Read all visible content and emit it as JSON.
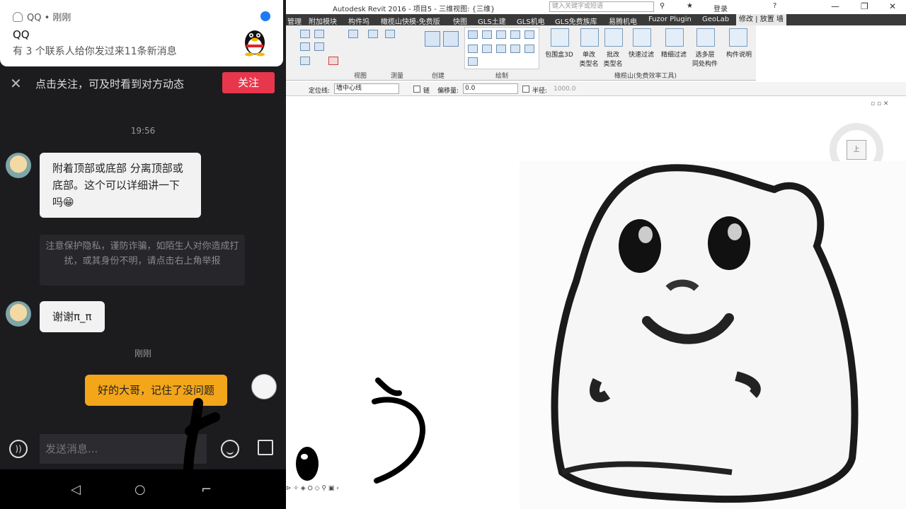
{
  "notification": {
    "app": "QQ • 刚刚",
    "title": "QQ",
    "body": "有 3 个联系人给你发过来11条新消息"
  },
  "follow_bar": {
    "close": "✕",
    "hint": "点击关注，可及时看到对方动态",
    "button": "关注"
  },
  "chat": {
    "time1": "19:56",
    "msg1": "附着顶部或底部 分离顶部或底部。这个可以详细讲一下吗😁",
    "notice": "注意保护隐私，谨防诈骗，如陌生人对你造成打扰，或其身份不明，请点击右上角举报",
    "msg2": "谢谢π_π",
    "time2": "刚刚",
    "msg3": "好的大哥，记住了没问题"
  },
  "input": {
    "placeholder": "发送消息..."
  },
  "nav": {
    "back": "◁",
    "home": "○",
    "recent": "⌐"
  },
  "revit": {
    "title": "Autodesk Revit 2016 -    项目5 - 三维视图: {三维}",
    "search_placeholder": "键入关键字或短语",
    "login": "登录",
    "tabs": [
      "管理",
      "附加模块",
      "构件坞",
      "橄榄山快模-免费版",
      "快图",
      "GLS土建",
      "GLS机电",
      "GLS免费族库",
      "易腾机电",
      "Fuzor Plugin",
      "GeoLab",
      "修改 | 放置 墙"
    ],
    "groups": [
      "视图",
      "测量",
      "创建",
      "绘制"
    ],
    "olive_tools": [
      "包围盒3D",
      "单改\n类型名",
      "批改\n类型名",
      "快速过滤",
      "精细过滤",
      "选多层\n同处构件",
      "构件说明"
    ],
    "olive_group": "橄榄山(免费效率工具)",
    "options": {
      "locate_label": "定位线:",
      "locate_value": "墙中心线",
      "chain_label": "链",
      "offset_label": "偏移量:",
      "offset_value": "0.0",
      "radius_label": "半径:",
      "radius_value": "1000.0"
    },
    "viewcube_label": "上"
  },
  "colors": {
    "phone_bg": "#1c1c1f",
    "follow_button": "#e8364c",
    "my_bubble": "#f3a61a",
    "active_tab": "#e7e7e7"
  }
}
